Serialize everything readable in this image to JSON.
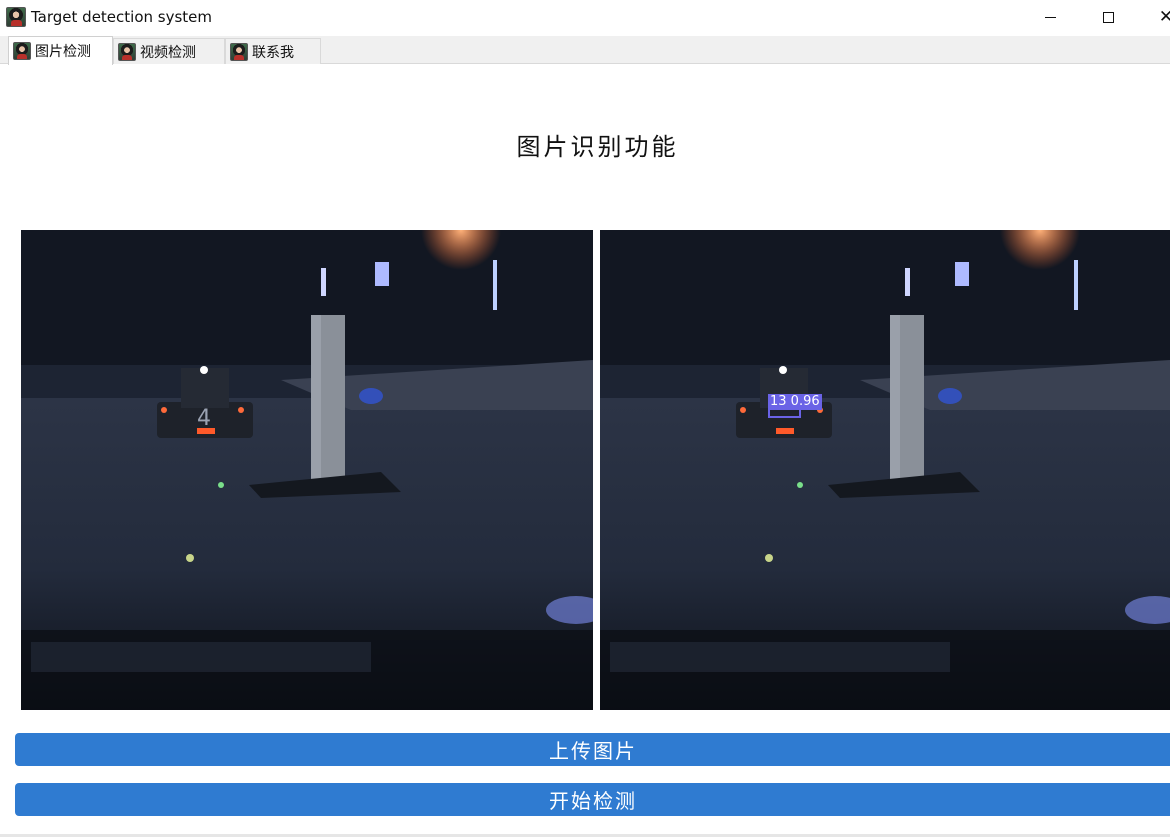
{
  "window": {
    "title": "Target detection system",
    "icon": "app-avatar-icon",
    "controls": [
      "minimize-icon",
      "maximize-icon",
      "close-icon"
    ]
  },
  "tabs": [
    {
      "label": "图片检测",
      "active": true
    },
    {
      "label": "视频检测",
      "active": false
    },
    {
      "label": "联系我",
      "active": false
    }
  ],
  "main": {
    "heading": "图片识别功能",
    "detection": {
      "label": "13 0.96",
      "color": "#6a63e6"
    },
    "buttons": {
      "upload": "上传图片",
      "detect": "开始检测"
    },
    "button_color": "#2f7bd1"
  }
}
